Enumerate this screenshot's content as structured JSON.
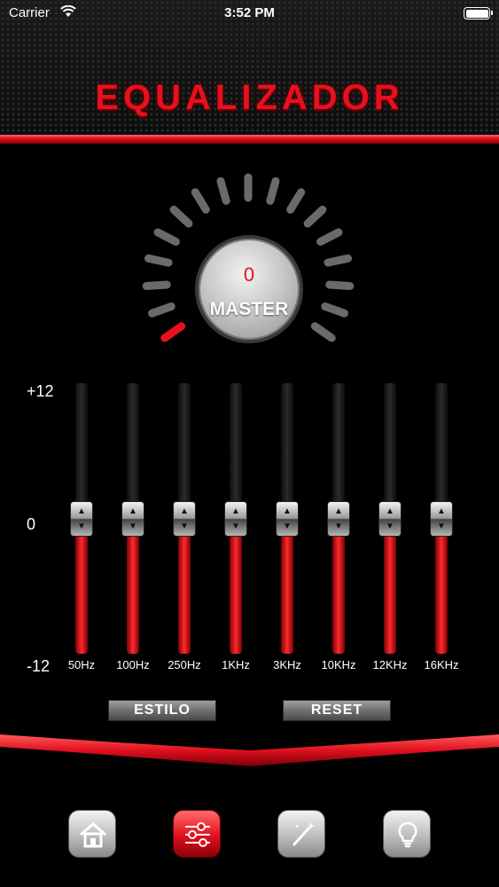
{
  "status_bar": {
    "carrier": "Carrier",
    "time": "3:52 PM"
  },
  "header": {
    "title": "EQUALIZADOR"
  },
  "master": {
    "value": "0",
    "label": "MASTER"
  },
  "scale": {
    "top": "+12",
    "middle": "0",
    "bottom": "-12"
  },
  "bands": [
    {
      "label": "50Hz",
      "gain_db": 0
    },
    {
      "label": "100Hz",
      "gain_db": 0
    },
    {
      "label": "250Hz",
      "gain_db": 0
    },
    {
      "label": "1KHz",
      "gain_db": 0
    },
    {
      "label": "3KHz",
      "gain_db": 0
    },
    {
      "label": "10KHz",
      "gain_db": 0
    },
    {
      "label": "12KHz",
      "gain_db": 0
    },
    {
      "label": "16KHz",
      "gain_db": 0
    }
  ],
  "buttons": {
    "style_label": "ESTILO",
    "reset_label": "RESET"
  },
  "nav": [
    {
      "icon": "home-icon"
    },
    {
      "icon": "equalizer-icon",
      "active": true
    },
    {
      "icon": "magic-wand-icon"
    },
    {
      "icon": "lightbulb-icon"
    }
  ],
  "colors": {
    "accent": "#e8101e",
    "background": "#000000"
  }
}
